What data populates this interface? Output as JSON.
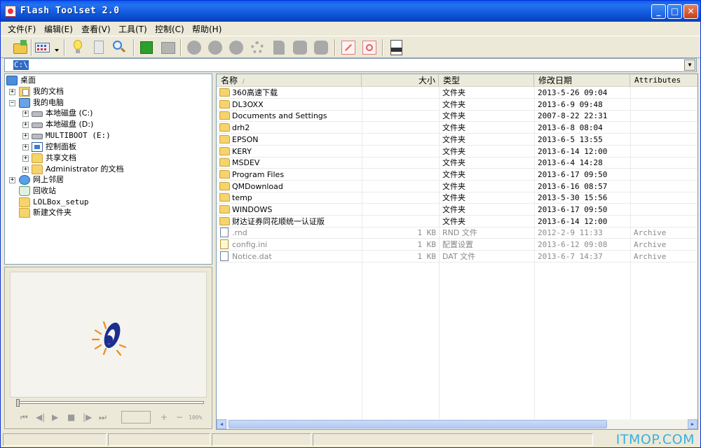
{
  "window": {
    "title": "Flash Toolset 2.0",
    "controls": {
      "minimize": "_",
      "maximize": "□",
      "close": "✕"
    }
  },
  "menu": [
    {
      "label": "文件(F)"
    },
    {
      "label": "编辑(E)"
    },
    {
      "label": "查看(V)"
    },
    {
      "label": "工具(T)"
    },
    {
      "label": "控制(C)"
    },
    {
      "label": "帮助(H)"
    }
  ],
  "toolbar": {
    "icons": [
      "open-folder-icon",
      "view-icon",
      "dropdown-arrow-icon",
      "lightbulb-icon",
      "document-icon",
      "search-icon",
      "green-square-icon",
      "gray-square-icon",
      "circle-icon",
      "arrow-icon",
      "globe-icon",
      "gear-icon",
      "page-icon",
      "rounded-square-icon",
      "rounded-square-icon",
      "external-link-icon",
      "link-icon",
      "news-icon"
    ]
  },
  "address": {
    "value": "C:\\"
  },
  "tree": [
    {
      "label": "桌面",
      "icon": "desktop-icon",
      "level": 0,
      "expander": ""
    },
    {
      "label": "我的文档",
      "icon": "documents-icon",
      "level": 1,
      "expander": "+"
    },
    {
      "label": "我的电脑",
      "icon": "computer-icon",
      "level": 1,
      "expander": "−"
    },
    {
      "label": "本地磁盘 (C:)",
      "icon": "drive-icon",
      "level": 2,
      "expander": "+"
    },
    {
      "label": "本地磁盘 (D:)",
      "icon": "drive-icon",
      "level": 2,
      "expander": "+"
    },
    {
      "label": "MULTIBOOT (E:)",
      "icon": "drive-icon",
      "level": 2,
      "expander": "+"
    },
    {
      "label": "控制面板",
      "icon": "control-panel-icon",
      "level": 2,
      "expander": "+"
    },
    {
      "label": "共享文档",
      "icon": "folder-icon",
      "level": 2,
      "expander": "+"
    },
    {
      "label": "Administrator 的文档",
      "icon": "folder-icon",
      "level": 2,
      "expander": "+"
    },
    {
      "label": "网上邻居",
      "icon": "network-icon",
      "level": 1,
      "expander": "+"
    },
    {
      "label": "回收站",
      "icon": "recycle-bin-icon",
      "level": 1,
      "expander": ""
    },
    {
      "label": "LOLBox_setup",
      "icon": "folder-icon",
      "level": 1,
      "expander": ""
    },
    {
      "label": "新建文件夹",
      "icon": "folder-icon",
      "level": 1,
      "expander": ""
    }
  ],
  "preview": {
    "controls": [
      "⏮",
      "◀|",
      "▶",
      "■",
      "|▶",
      "⏭"
    ],
    "plus": "+",
    "minus": "−",
    "zoom": "100%"
  },
  "columns": {
    "name": "名称",
    "sort_indicator": "/",
    "size": "大小",
    "type": "类型",
    "modified": "修改日期",
    "attributes": "Attributes"
  },
  "files": [
    {
      "name": "360高速下载",
      "size": "",
      "type": "文件夹",
      "modified": "2013-5-26 09:04",
      "attributes": "",
      "icon": "folder"
    },
    {
      "name": "DL3OXX",
      "size": "",
      "type": "文件夹",
      "modified": "2013-6-9 09:48",
      "attributes": "",
      "icon": "folder"
    },
    {
      "name": "Documents and Settings",
      "size": "",
      "type": "文件夹",
      "modified": "2007-8-22 22:31",
      "attributes": "",
      "icon": "folder"
    },
    {
      "name": "drh2",
      "size": "",
      "type": "文件夹",
      "modified": "2013-6-8 08:04",
      "attributes": "",
      "icon": "folder"
    },
    {
      "name": "EPSON",
      "size": "",
      "type": "文件夹",
      "modified": "2013-6-5 13:55",
      "attributes": "",
      "icon": "folder"
    },
    {
      "name": "KERY",
      "size": "",
      "type": "文件夹",
      "modified": "2013-6-14 12:00",
      "attributes": "",
      "icon": "folder"
    },
    {
      "name": "MSDEV",
      "size": "",
      "type": "文件夹",
      "modified": "2013-6-4 14:28",
      "attributes": "",
      "icon": "folder"
    },
    {
      "name": "Program Files",
      "size": "",
      "type": "文件夹",
      "modified": "2013-6-17 09:50",
      "attributes": "",
      "icon": "folder"
    },
    {
      "name": "QMDownload",
      "size": "",
      "type": "文件夹",
      "modified": "2013-6-16 08:57",
      "attributes": "",
      "icon": "folder"
    },
    {
      "name": "temp",
      "size": "",
      "type": "文件夹",
      "modified": "2013-5-30 15:56",
      "attributes": "",
      "icon": "folder"
    },
    {
      "name": "WINDOWS",
      "size": "",
      "type": "文件夹",
      "modified": "2013-6-17 09:50",
      "attributes": "",
      "icon": "folder"
    },
    {
      "name": "财达证券同花顺统一认证版",
      "size": "",
      "type": "文件夹",
      "modified": "2013-6-14 12:00",
      "attributes": "",
      "icon": "folder"
    },
    {
      "name": ".rnd",
      "size": "1 KB",
      "type": "RND 文件",
      "modified": "2012-2-9 11:33",
      "attributes": "Archive",
      "icon": "file"
    },
    {
      "name": "config.ini",
      "size": "1 KB",
      "type": "配置设置",
      "modified": "2013-6-12 09:08",
      "attributes": "Archive",
      "icon": "settings"
    },
    {
      "name": "Notice.dat",
      "size": "1 KB",
      "type": "DAT 文件",
      "modified": "2013-6-7 14:37",
      "attributes": "Archive",
      "icon": "file"
    }
  ],
  "watermark": "ITMOP.COM"
}
